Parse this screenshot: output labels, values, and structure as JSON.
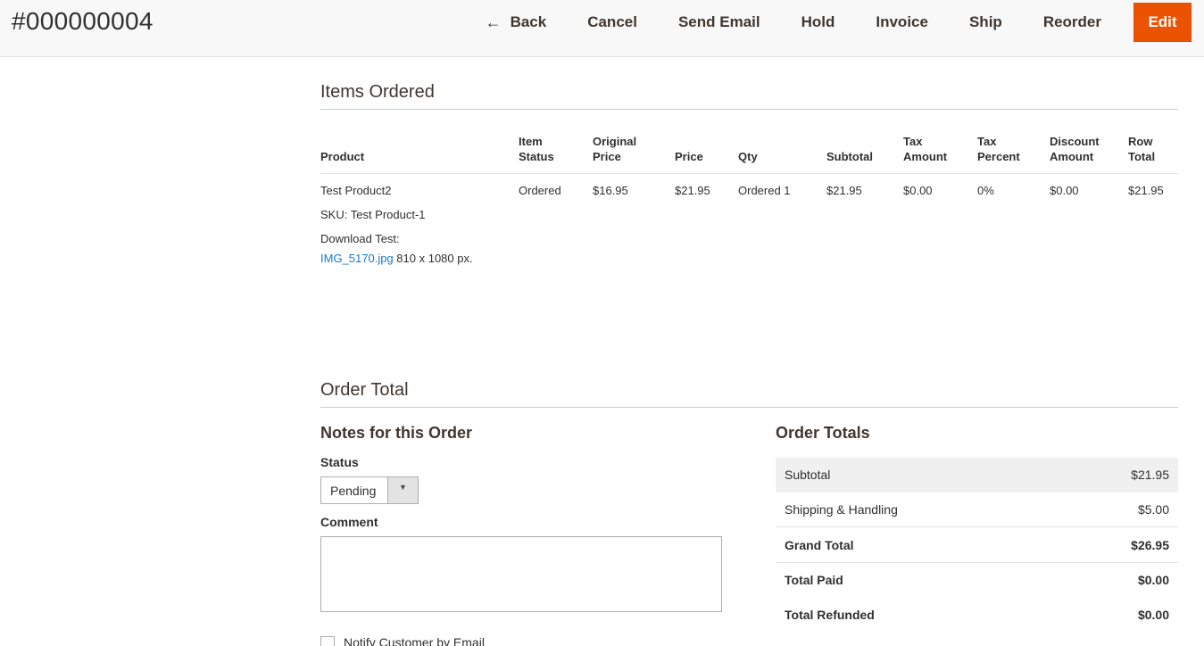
{
  "header": {
    "order_id": "#000000004",
    "actions": {
      "back": "Back",
      "cancel": "Cancel",
      "send_email": "Send Email",
      "hold": "Hold",
      "invoice": "Invoice",
      "ship": "Ship",
      "reorder": "Reorder",
      "edit": "Edit"
    }
  },
  "items_ordered": {
    "title": "Items Ordered",
    "columns": {
      "product": "Product",
      "item_status": [
        "Item",
        "Status"
      ],
      "original_price": [
        "Original",
        "Price"
      ],
      "price": "Price",
      "qty": "Qty",
      "subtotal": "Subtotal",
      "tax_amount": [
        "Tax",
        "Amount"
      ],
      "tax_percent": [
        "Tax",
        "Percent"
      ],
      "discount_amount": [
        "Discount",
        "Amount"
      ],
      "row_total": [
        "Row",
        "Total"
      ]
    },
    "row": {
      "product_name": "Test Product2",
      "sku": "SKU: Test Product-1",
      "option_label": "Download Test:",
      "file_link": "IMG_5170.jpg",
      "file_dims": "810 x 1080 px.",
      "item_status": "Ordered",
      "original_price": "$16.95",
      "price": "$21.95",
      "qty": "Ordered 1",
      "subtotal": "$21.95",
      "tax_amount": "$0.00",
      "tax_percent": "0%",
      "discount_amount": "$0.00",
      "row_total": "$21.95"
    }
  },
  "order_total": {
    "title": "Order Total",
    "notes": {
      "title": "Notes for this Order",
      "status_label": "Status",
      "status_value": "Pending",
      "comment_label": "Comment",
      "notify_label": "Notify Customer by Email"
    },
    "totals": {
      "title": "Order Totals",
      "rows": [
        {
          "label": "Subtotal",
          "value": "$21.95"
        },
        {
          "label": "Shipping & Handling",
          "value": "$5.00"
        },
        {
          "label": "Grand Total",
          "value": "$26.95"
        },
        {
          "label": "Total Paid",
          "value": "$0.00"
        },
        {
          "label": "Total Refunded",
          "value": "$0.00"
        }
      ]
    }
  },
  "colors": {
    "primary_button": "#eb5202",
    "link": "#1979c3",
    "header_bg": "#f8f8f8"
  }
}
